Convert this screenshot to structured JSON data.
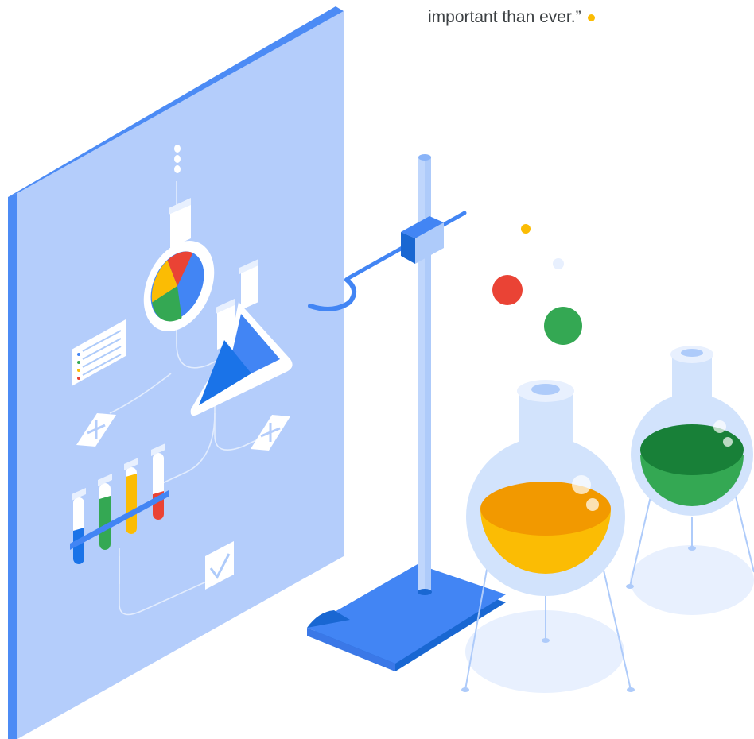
{
  "quote": {
    "text": "important than ever.”"
  },
  "colors": {
    "blue": "#4285f4",
    "red": "#ea4335",
    "yellow": "#fbbc04",
    "green": "#34a853",
    "light_blue": "#aecbfa",
    "panel_blue": "#b3cdfb",
    "dark_blue": "#1967d2"
  },
  "icons": {
    "pie": "pie-chart-icon",
    "flask": "flask-icon",
    "check": "checkbox-icon",
    "list": "list-card-icon"
  }
}
